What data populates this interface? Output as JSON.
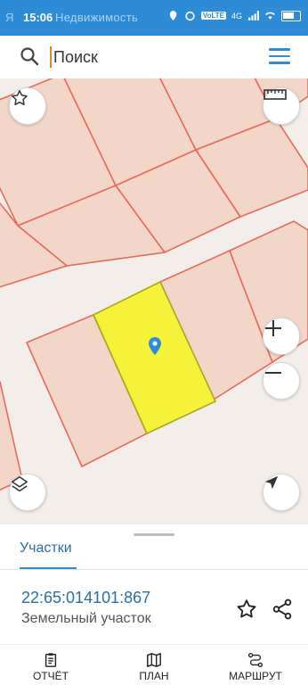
{
  "status_bar": {
    "time": "15:06",
    "app_hint": "Я",
    "app_title": "Недвижимость",
    "badge": "VoLTE",
    "network": "4G"
  },
  "search": {
    "placeholder": "Поиск",
    "value": ""
  },
  "map": {
    "highlight_color": "#f5f23a",
    "parcel_fill": "#f2d8cc",
    "parcel_stroke": "#e86a5a",
    "marker_color": "#2e8bd6"
  },
  "sheet": {
    "tab_label": "Участки",
    "cadastral_number": "22:65:014101:867",
    "object_type": "Земельный участок"
  },
  "bottom_nav": {
    "report": "ОТЧЁТ",
    "plan": "ПЛАН",
    "route": "МАРШРУТ"
  },
  "colors": {
    "accent": "#2e8bd6",
    "link": "#2a6ea8"
  }
}
